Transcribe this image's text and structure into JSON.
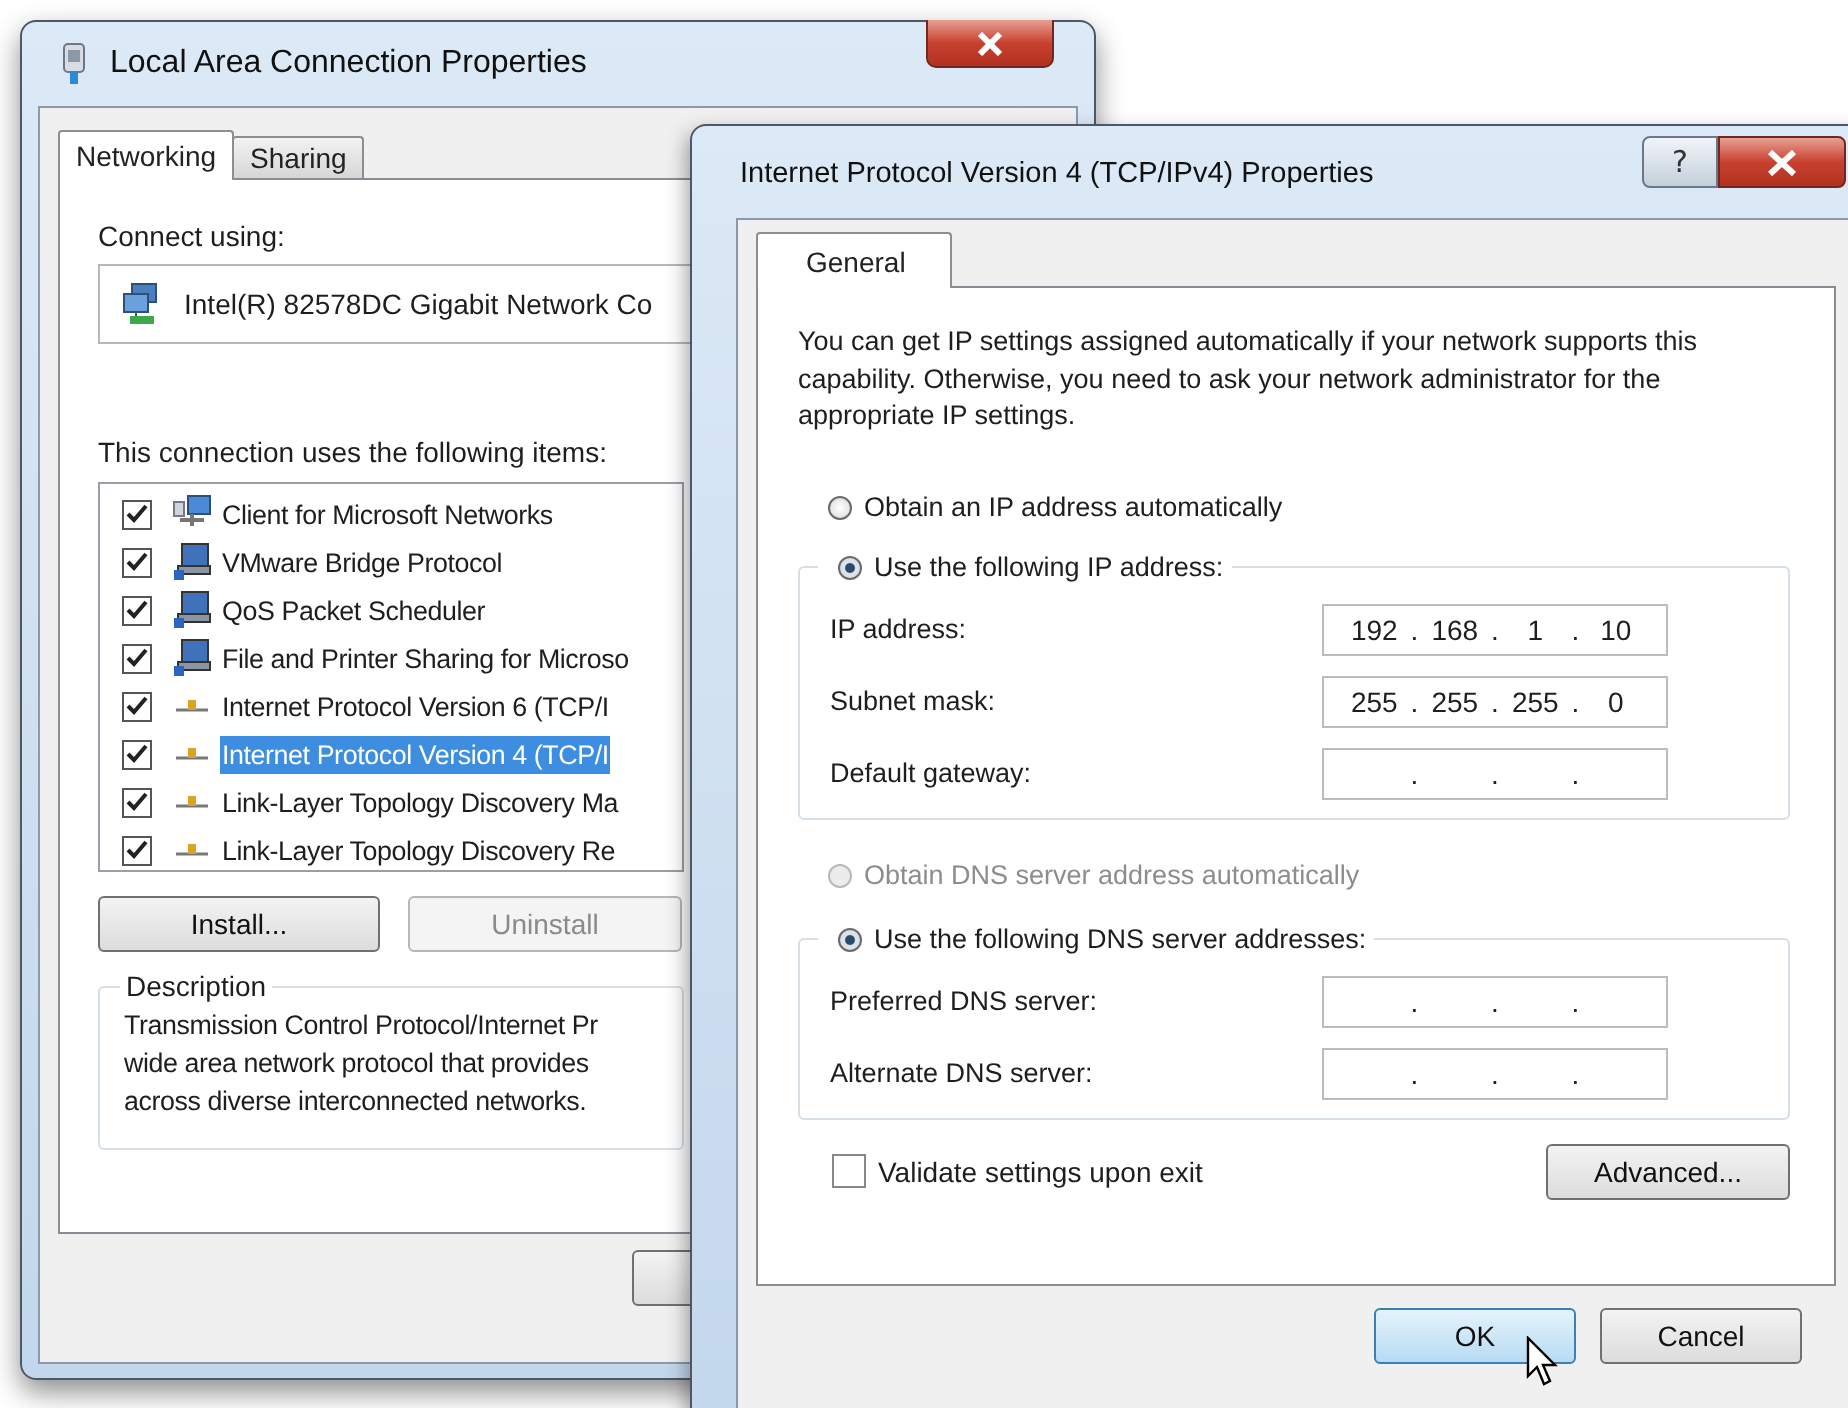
{
  "network_properties": {
    "title": "Local Area Connection Properties",
    "tabs": [
      {
        "label": "Networking",
        "selected": true
      },
      {
        "label": "Sharing",
        "selected": false
      }
    ],
    "connect_label": "Connect using:",
    "adapter": "Intel(R) 82578DC Gigabit Network Co",
    "items_label": "This connection uses the following items:",
    "items": [
      {
        "kind": "client",
        "label": "Client for Microsoft Networks",
        "checked": true,
        "selected": false
      },
      {
        "kind": "service",
        "label": "VMware Bridge Protocol",
        "checked": true,
        "selected": false
      },
      {
        "kind": "service",
        "label": "QoS Packet Scheduler",
        "checked": true,
        "selected": false
      },
      {
        "kind": "service",
        "label": "File and Printer Sharing for Microso",
        "checked": true,
        "selected": false
      },
      {
        "kind": "protocol",
        "label": "Internet Protocol Version 6 (TCP/I",
        "checked": true,
        "selected": false
      },
      {
        "kind": "protocol",
        "label": "Internet Protocol Version 4 (TCP/I",
        "checked": true,
        "selected": true
      },
      {
        "kind": "protocol",
        "label": "Link-Layer Topology Discovery Ma",
        "checked": true,
        "selected": false
      },
      {
        "kind": "protocol",
        "label": "Link-Layer Topology Discovery Re",
        "checked": true,
        "selected": false
      }
    ],
    "buttons": [
      {
        "label": "Install...",
        "disabled": false
      },
      {
        "label": "Uninstall",
        "disabled": true
      }
    ],
    "description": {
      "legend": "Description",
      "lines": [
        "Transmission Control Protocol/Internet Pr",
        "wide area network protocol that provides",
        "across diverse interconnected networks."
      ]
    }
  },
  "ipv4_properties": {
    "title": "Internet Protocol Version 4 (TCP/IPv4) Properties",
    "title_buttons": [
      {
        "kind": "help",
        "glyph": "?"
      },
      {
        "kind": "close"
      }
    ],
    "tabs": [
      {
        "label": "General",
        "selected": true
      }
    ],
    "intro": "You can get IP settings assigned automatically if your network supports this capability. Otherwise, you need to ask your network administrator for the appropriate IP settings.",
    "separator": ".",
    "sections": [
      {
        "auto": {
          "label": "Obtain an IP address automatically",
          "selected": false,
          "disabled": false
        },
        "manual": {
          "label": "Use the following IP address:",
          "selected": true
        },
        "fields": [
          {
            "label": "IP address:",
            "octets": [
              "192",
              "168",
              "1",
              "10"
            ]
          },
          {
            "label": "Subnet mask:",
            "octets": [
              "255",
              "255",
              "255",
              "0"
            ]
          },
          {
            "label": "Default gateway:"
          }
        ]
      },
      {
        "auto": {
          "label": "Obtain DNS server address automatically",
          "selected": false,
          "disabled": true
        },
        "manual": {
          "label": "Use the following DNS server addresses:",
          "selected": true
        },
        "fields": [
          {
            "label": "Preferred DNS server:"
          },
          {
            "label": "Alternate DNS server:"
          }
        ]
      }
    ],
    "validate": {
      "label": "Validate settings upon exit",
      "checked": false
    },
    "advanced": "Advanced...",
    "buttons": [
      {
        "label": "OK",
        "default": true
      },
      {
        "label": "Cancel",
        "default": false
      }
    ]
  }
}
